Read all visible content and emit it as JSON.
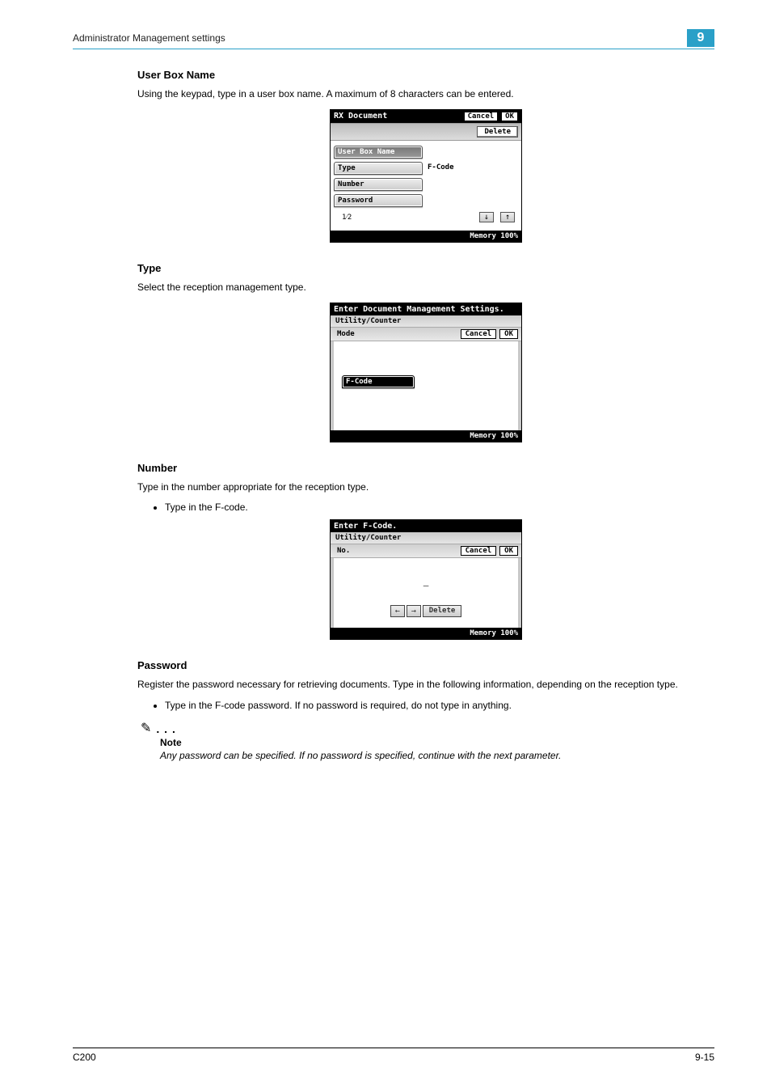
{
  "header": {
    "title": "Administrator Management settings",
    "chapter": "9"
  },
  "sections": {
    "userBoxName": {
      "title": "User Box Name",
      "desc": "Using the keypad, type in a user box name. A maximum of 8 characters can be entered."
    },
    "type": {
      "title": "Type",
      "desc": "Select the reception management type."
    },
    "number": {
      "title": "Number",
      "desc": "Type in the number appropriate for the reception type.",
      "bullet": "Type in the F-code."
    },
    "password": {
      "title": "Password",
      "desc": "Register the password necessary for retrieving documents. Type in the following information, depending on the reception type.",
      "bullet": "Type in the F-code password. If no password is required, do not type in anything."
    }
  },
  "lcd1": {
    "title": "RX Document",
    "cancel": "Cancel",
    "ok": "OK",
    "delete": "Delete",
    "rows": {
      "userBoxName": "User Box Name",
      "type": "Type",
      "typeValue": "F-Code",
      "number": "Number",
      "password": "Password"
    },
    "pager": "1⁄2",
    "memory": "Memory 100%"
  },
  "lcd2": {
    "prompt": "Enter Document Management Settings.",
    "breadcrumb": "Utility/Counter",
    "mode": "Mode",
    "cancel": "Cancel",
    "ok": "OK",
    "fcode": "F-Code",
    "memory": "Memory 100%"
  },
  "lcd3": {
    "prompt": "Enter F-Code.",
    "breadcrumb": "Utility/Counter",
    "no": "No.",
    "cancel": "Cancel",
    "ok": "OK",
    "cursor": "—",
    "delete": "Delete",
    "memory": "Memory 100%"
  },
  "note": {
    "label": "Note",
    "text": "Any password can be specified. If no password is specified, continue with the next parameter."
  },
  "footer": {
    "left": "C200",
    "right": "9-15"
  }
}
